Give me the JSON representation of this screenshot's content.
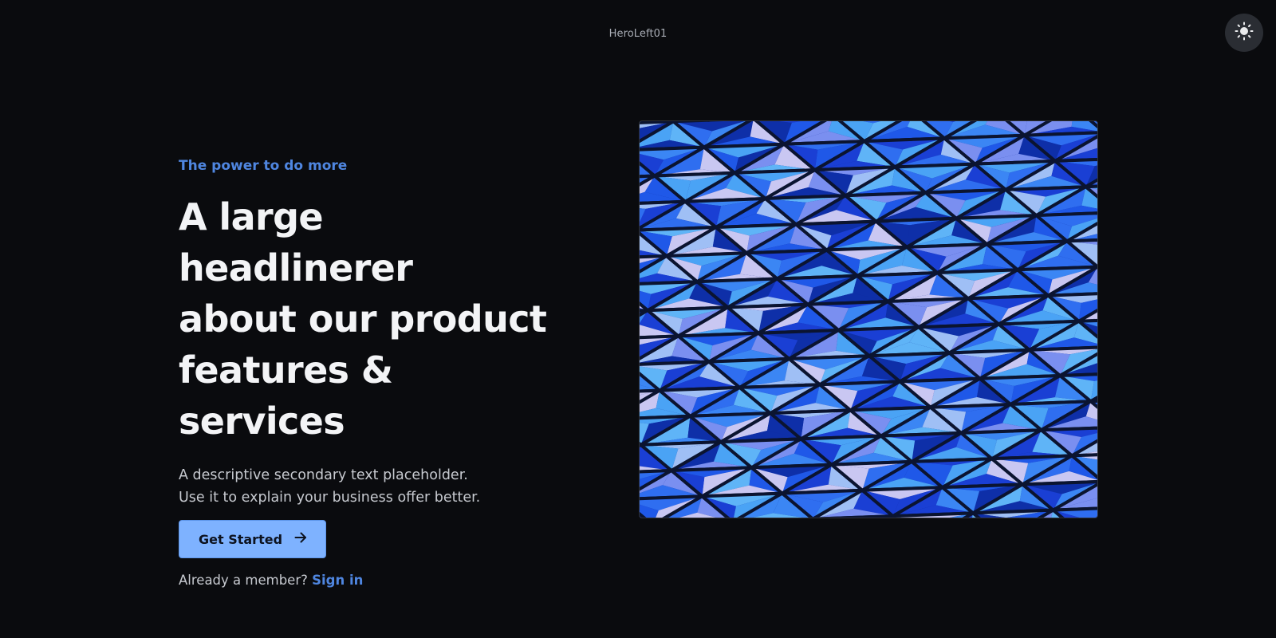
{
  "component_name": "HeroLeft01",
  "theme_toggle": {
    "icon": "sun-icon"
  },
  "hero": {
    "eyebrow": "The power to do more",
    "headline_lines": [
      "A large headlinerer",
      "about our product",
      "features & services"
    ],
    "description_lines": [
      "A descriptive secondary text placeholder.",
      "Use it to explain your business offer better."
    ],
    "cta": {
      "label": "Get Started",
      "icon": "arrow-right-icon"
    },
    "member_prompt": "Already a member?",
    "sign_in_label": "Sign in"
  },
  "colors": {
    "background": "#0a0b0e",
    "accent": "#4f86e0",
    "button": "#7eb2ff",
    "text": "#f3f4f6"
  }
}
